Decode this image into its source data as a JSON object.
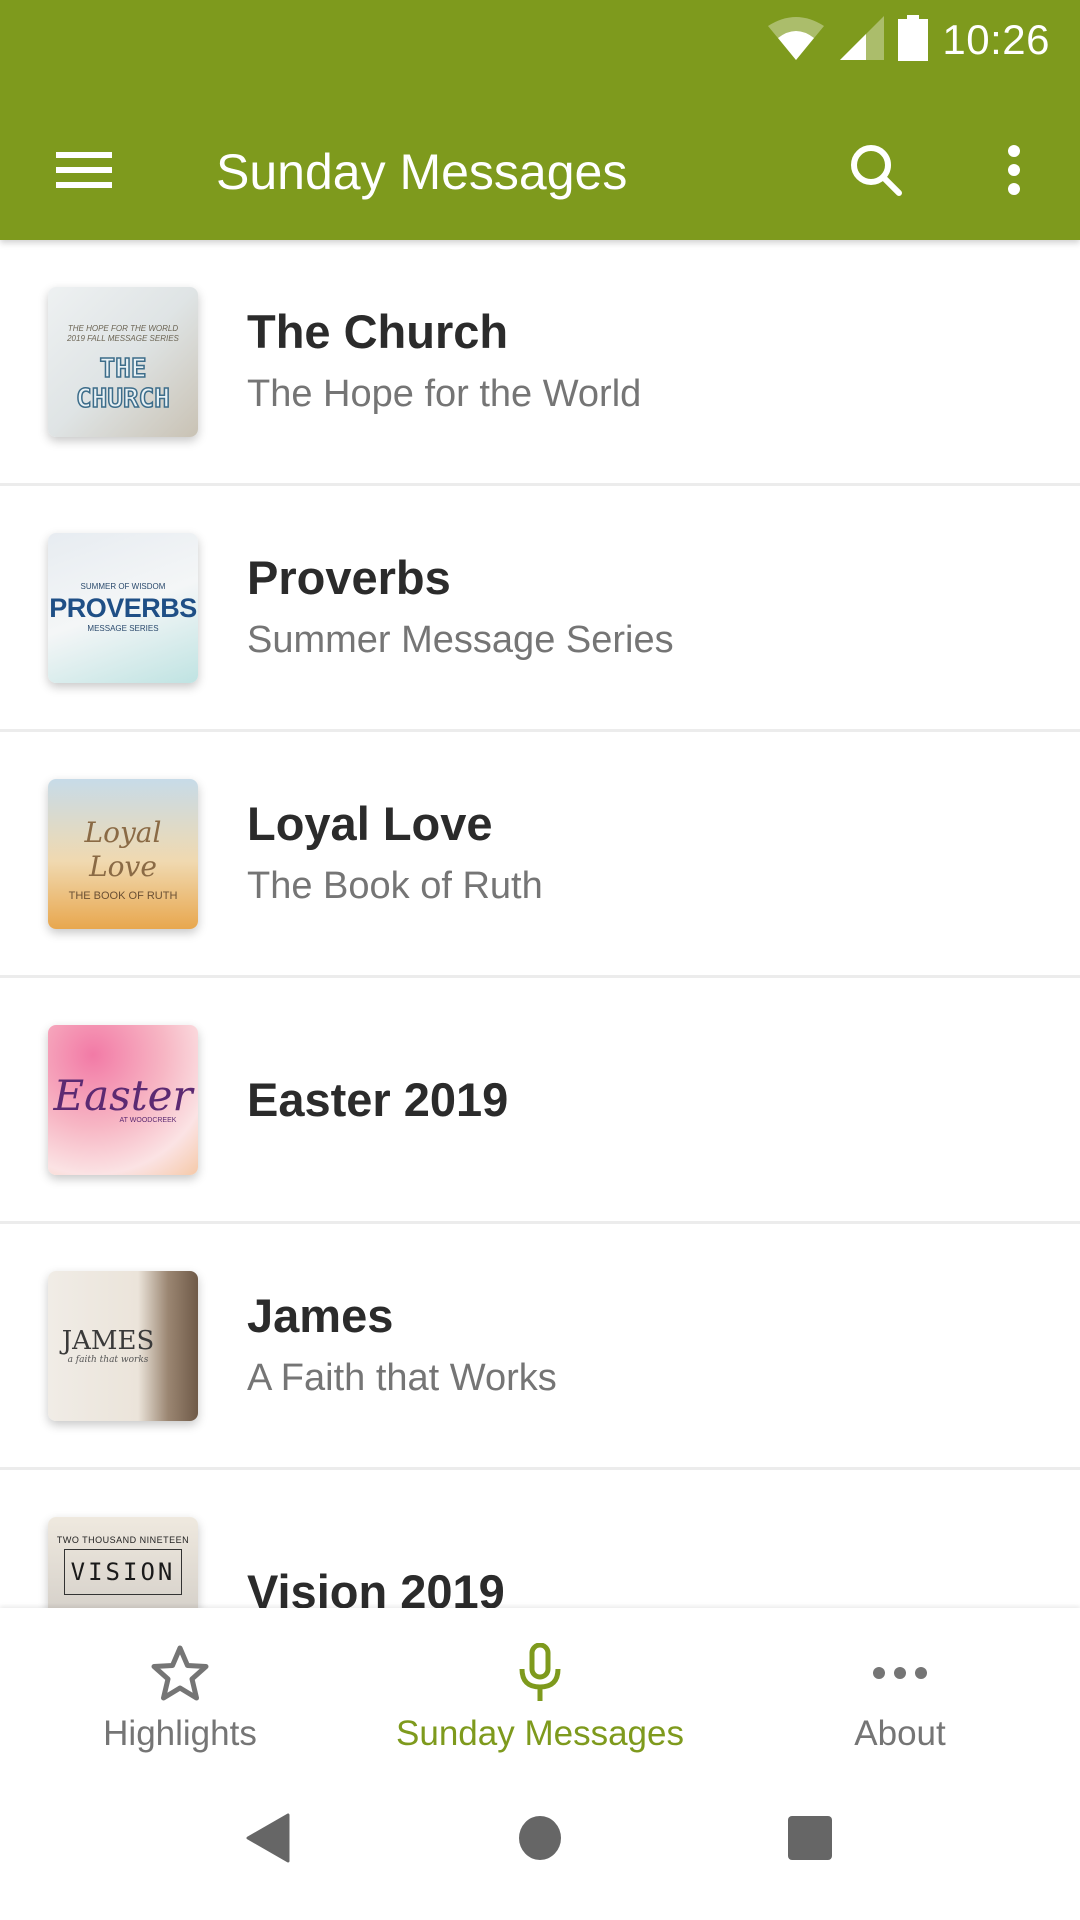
{
  "status_bar": {
    "time": "10:26",
    "icons": [
      "wifi-icon",
      "cell-signal-icon",
      "battery-icon"
    ]
  },
  "toolbar": {
    "title": "Sunday Messages",
    "menu_icon": "hamburger-menu-icon",
    "search_icon": "search-icon",
    "more_icon": "more-vertical-icon"
  },
  "colors": {
    "primary": "#7e9a1d",
    "title_text": "#2b2b2b",
    "subtitle_text": "#757575",
    "inactive_nav": "#757575",
    "system_nav": "#666666"
  },
  "series": [
    {
      "title": "The Church",
      "subtitle": "The Hope for the World",
      "art": {
        "line1": "THE HOPE FOR THE WORLD",
        "line2": "2019 FALL MESSAGE SERIES",
        "big": "THE CHURCH"
      }
    },
    {
      "title": "Proverbs",
      "subtitle": "Summer Message Series",
      "art": {
        "line1": "SUMMER OF WISDOM",
        "big": "PROVERBS",
        "line2": "MESSAGE SERIES"
      }
    },
    {
      "title": "Loyal Love",
      "subtitle": "The Book of Ruth",
      "art": {
        "big": "Loyal Love",
        "line1": "THE BOOK OF RUTH"
      }
    },
    {
      "title": "Easter 2019",
      "subtitle": "",
      "art": {
        "big": "Easter",
        "line1": "AT WOODCREEK"
      }
    },
    {
      "title": "James",
      "subtitle": "A Faith that Works",
      "art": {
        "big": "JAMES",
        "line1": "a faith that works"
      }
    },
    {
      "title": "Vision 2019",
      "subtitle": "",
      "art": {
        "line1": "TWO THOUSAND NINETEEN",
        "big": "VISION"
      }
    }
  ],
  "bottom_nav": {
    "items": [
      {
        "label": "Highlights",
        "icon": "star-outline-icon",
        "active": false
      },
      {
        "label": "Sunday Messages",
        "icon": "microphone-icon",
        "active": true
      },
      {
        "label": "About",
        "icon": "more-horizontal-icon",
        "active": false
      }
    ]
  },
  "system_nav": {
    "buttons": [
      "back-icon",
      "home-icon",
      "recents-icon"
    ]
  }
}
